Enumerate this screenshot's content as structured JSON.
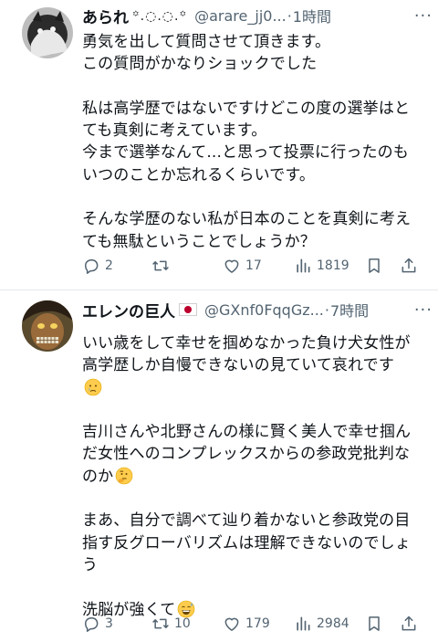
{
  "posts": [
    {
      "name": "あられ",
      "decoration": "꙳.◌.◌.꙳",
      "handle": "@arare_jj0...",
      "separator": "·",
      "time": "1時間",
      "more": "···",
      "lines": [
        "勇気を出して質問させて頂きます。",
        "この質問がかなりショックでした",
        "",
        "私は高学歴ではないですけどこの度の選挙はと",
        "ても真剣に考えています。",
        "今まで選挙なんて...と思って投票に行ったのも",
        "いつのことか忘れるくらいです。",
        "",
        "そんな学歴のない私が日本のことを真剣に考え",
        "ても無駄ということでしょうか？"
      ],
      "replies": "2",
      "reposts": "",
      "likes": "17",
      "views": "1819"
    },
    {
      "name": "エレンの巨人",
      "handle": "@GXnf0FqqGz...",
      "separator": "·",
      "time": "7時間",
      "more": "···",
      "lines": [
        "いい歳をして幸せを掴めなかった負け犬女性が",
        "高学歴しか自慢できないの見ていて哀れです",
        "",
        "",
        "吉川さんや北野さんの様に賢く美人で幸せ掴ん",
        "だ女性へのコンプレックスからの参政党批判な",
        "のか",
        "",
        "まあ、自分で調べて辿り着かないと参政党の目",
        "指す反グローバリズムは理解できないのでしょ",
        "う",
        "",
        "洗脳が強くて"
      ],
      "replies": "3",
      "reposts": "10",
      "likes": "179",
      "views": "2984"
    }
  ],
  "colors": {
    "text": "#0f1419",
    "secondary": "#536471",
    "divider": "#e7e9eb",
    "flag_red": "#bc002d"
  },
  "icons": [
    "reply-icon",
    "repost-icon",
    "like-icon",
    "views-icon",
    "bookmark-icon",
    "share-icon",
    "crying-face-emoji",
    "thinking-face-emoji",
    "sweat-smile-emoji"
  ]
}
